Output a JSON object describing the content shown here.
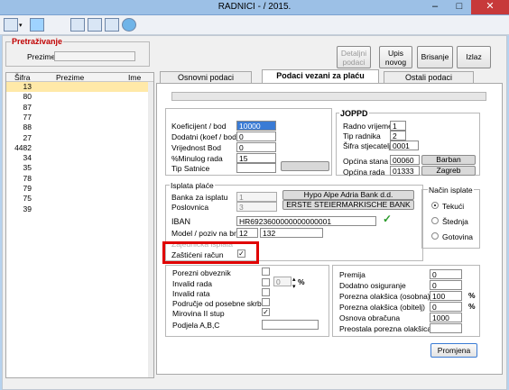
{
  "window": {
    "title": "RADNICI -                    /  2015.",
    "min": "–",
    "max": "□",
    "close": "✕"
  },
  "toolbar": {
    "icons": [
      "printer-icon",
      "image-icon",
      "list-icon",
      "copy-icon",
      "table-icon",
      "globe-icon"
    ]
  },
  "search": {
    "legend": "Pretraživanje",
    "prezime_label": "Prezime",
    "prezime_value": ""
  },
  "actions": {
    "detalji": "Detaljni\npodaci",
    "upis": "Upis\nnovog",
    "brisanje": "Brisanje",
    "izlaz": "Izlaz"
  },
  "list": {
    "headers": [
      "Šifra",
      "Prezime",
      "Ime"
    ],
    "rows": [
      "13",
      "80",
      "87",
      "77",
      "88",
      "27",
      "4482",
      "34",
      "35",
      "78",
      "79",
      "75",
      "39"
    ]
  },
  "tabs": [
    "Osnovni podaci",
    "Podaci vezani za plaću",
    "Ostali podaci"
  ],
  "main": {
    "koef_label": "Koeficijent / bod",
    "koef": "10000",
    "dodatni_label": "Dodatni (koef / bod)",
    "dodatni": "0",
    "vrijednost_label": "Vrijednost Bod",
    "vrijednost": "0",
    "minulog_label": "%Minulog rada",
    "minulog": "15",
    "tip_satnice_label": "Tip Satnice",
    "tip_satnice": ""
  },
  "joppd": {
    "title": "JOPPD",
    "radno_label": "Radno vrijeme",
    "radno": "1",
    "tip_label": "Tip radnika",
    "tip": "2",
    "sifra_label": "Šifra stjecatelja",
    "sifra": "0001",
    "stana_label": "Općina stana",
    "stana_code": "00060",
    "stana_name": "Barban",
    "rada_label": "Općina rada",
    "rada_code": "01333",
    "rada_name": "Zagreb"
  },
  "isplata": {
    "title": "Isplata plaće",
    "banka_label": "Banka za isplatu",
    "banka": "1",
    "banka_name": "Hypo Alpe Adria Bank d.d.",
    "posl_label": "Poslovnica",
    "posl": "3",
    "posl_name": "ERSTE STEIERMARKISCHE BANK",
    "iban_label": "IBAN",
    "iban": "HR6923600000000000001",
    "check": "✓",
    "model_label": "Model / poziv na br.",
    "model": "12",
    "poziv": "132",
    "hidden_label": "Zajednička isplata",
    "zasticeni_label": "Zaštićeni račun",
    "zasticeni": "✓"
  },
  "nacin": {
    "title": "Način isplate",
    "options": [
      "Tekući",
      "Štednja",
      "Gotovina"
    ],
    "selected": "Tekući"
  },
  "bottom_left": {
    "porezni_label": "Porezni obveznik",
    "invalid_label": "Invalid rada",
    "invalid_val": "0",
    "invalid_pct": "%",
    "invalid_rata_label": "Invalid rata",
    "podrucje_label": "Područje od posebne skrbi",
    "mirovina_label": "Mirovina II stup",
    "mirovina": "✓",
    "podjela_label": "Podjela A,B,C"
  },
  "bottom_right": {
    "premija_label": "Premija",
    "premija": "0",
    "dodatno_label": "Dodatno osiguranje",
    "dodatno": "0",
    "olak_osob_label": "Porezna olakšica (osobna)",
    "olak_osob": "100",
    "olak_obit_label": "Porezna olakšica (obitelj)",
    "olak_obit": "0",
    "osnova_label": "Osnova obračuna",
    "osnova": "1000",
    "preostala_label": "Preostala porezna olakšica",
    "preostala": "",
    "pct": "%"
  },
  "promjena": "Promjena",
  "colors": {
    "highlight_box": "#e00000",
    "selected_row": "#ffe9a8",
    "accent": "#3a7bd5"
  }
}
